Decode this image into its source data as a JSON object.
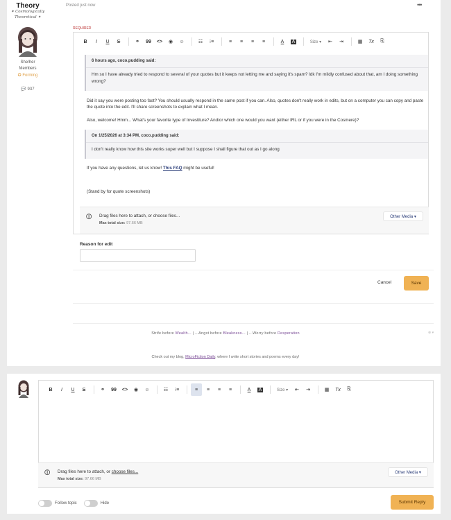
{
  "post": {
    "author": "Theory",
    "title_line1": "✦ Cosmologically",
    "title_line2": "Theoretical ✦",
    "pronouns": "She/her",
    "group": "Members",
    "rank": "✪ Forming",
    "post_count": "💬 937",
    "posted": "Posted just now",
    "more": "•••"
  },
  "editor": {
    "required": "REQUIRED",
    "toolbar": {
      "bold": "B",
      "italic": "I",
      "underline": "U",
      "strike": "S",
      "link": "⚭",
      "quote": "99",
      "code": "<>",
      "spoiler": "◉",
      "emoji": "☺",
      "bullets": "☷",
      "numbers": "⁝≡",
      "left": "≡",
      "center": "≡",
      "right": "≡",
      "justify": "≡",
      "color": "A",
      "bg": "A",
      "size": "Size ▾",
      "indent_out": "⇤",
      "indent_in": "⇥",
      "table": "▦",
      "clear": "Tx",
      "source": "⎘"
    },
    "quote1": {
      "header": "6 hours ago, coco.pudding said:",
      "body": "Hm so I have already tried to respond to several of your quotes but it keeps not letting me and saying it's spam? Idk I'm mildly confused about that, am I doing something wrong?"
    },
    "para1": "Did it say you were posting too fast? You should usually respond in the same post if you can. Also, quotes don't really work in edits, but on a computer you can copy and paste the quote into the edit. I'll share screenshots to explain what I mean.",
    "para2": "Also, welcome! Hmm... What's your favorite type of Investiture? And/or which one would you want (either IRL or if you were in the Cosmere)?",
    "quote2": {
      "header": "On 1/25/2026 at 3:34 PM, coco.pudding said:",
      "body": "I don't really know how this site works super well but I suppose I shall figure that out as I go along"
    },
    "para3_before": "If you have any questions, let us know! ",
    "para3_link": "This FAQ",
    "para3_after": " might be useful!",
    "para4": "(Stand by for quote screenshots)",
    "attach": {
      "drag": "Drag files here to attach, or choose files...",
      "max_label": "Max total size:",
      "max_value": "97.66 MB",
      "media": "Other Media ▾"
    }
  },
  "reason": {
    "label": "Reason for edit",
    "value": ""
  },
  "actions": {
    "cancel": "Cancel",
    "save": "Save"
  },
  "signature": {
    "part1": "Strife before ",
    "part1_em": "Wealth...",
    "sep1": " | ...Angst before ",
    "part2_em": "Bleakness...",
    "sep2": " | ...Worry before ",
    "part3_em": "Desperation",
    "close": "⊗ ▾",
    "blog_before": "Check out my blog, ",
    "blog_link": "MicroFiction Daily",
    "blog_after": ", where I write short stories and poems every day!"
  },
  "reply": {
    "attach": {
      "drag_before": "Drag files here to attach, or ",
      "drag_link": "choose files...",
      "max_label": "Max total size:",
      "max_value": "97.66 MB",
      "media": "Other Media ▾"
    },
    "follow": "Follow topic",
    "hide": "Hide",
    "submit": "Submit Reply"
  },
  "colors": {
    "accent": "#f0b254",
    "link": "#2a3c78",
    "signature_em": "#7a4b96",
    "rank": "#e0a24b"
  }
}
